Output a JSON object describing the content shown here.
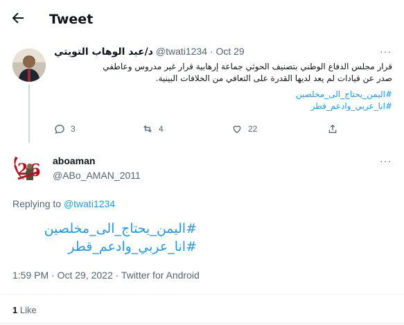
{
  "header": {
    "title": "Tweet",
    "back_icon": "arrow-left-icon"
  },
  "parent_tweet": {
    "author_name": "د/عبد الوهاب التويتي",
    "handle": "@twati1234",
    "date_sep": "·",
    "date": "Oct 29",
    "more": "···",
    "text_lines": [
      "قرار مجلس الدفاع الوطني بتصنيف الحوثي جماعة إرهابية قرار غير مدروس وعاطفي",
      "صدر عن قيادات لم يعد لديها القدرة على التعافي من الخلافات البينية."
    ],
    "hashtags": [
      "#اليمن_يحتاج_الى_مخلصين",
      "#انا_عربي_وادعم_قطر"
    ],
    "replies": "3",
    "retweets": "4",
    "likes": "22"
  },
  "reply_tweet": {
    "author_name": "aboaman",
    "handle": "@ABo_AMAN_2011",
    "more": "···",
    "replying_prefix": "Replying to",
    "replying_to": "@twati1234",
    "hashtags": [
      "#اليمن_يحتاج_الى_مخلصين",
      "#انا_عربي_وادعم_قطر"
    ],
    "meta": "1:59 PM · Oct 29, 2022 · Twitter for Android",
    "like_count": "1",
    "like_label": "Like"
  },
  "colors": {
    "accent": "#1d9bf0",
    "muted": "#536471",
    "text": "#0f1419"
  }
}
